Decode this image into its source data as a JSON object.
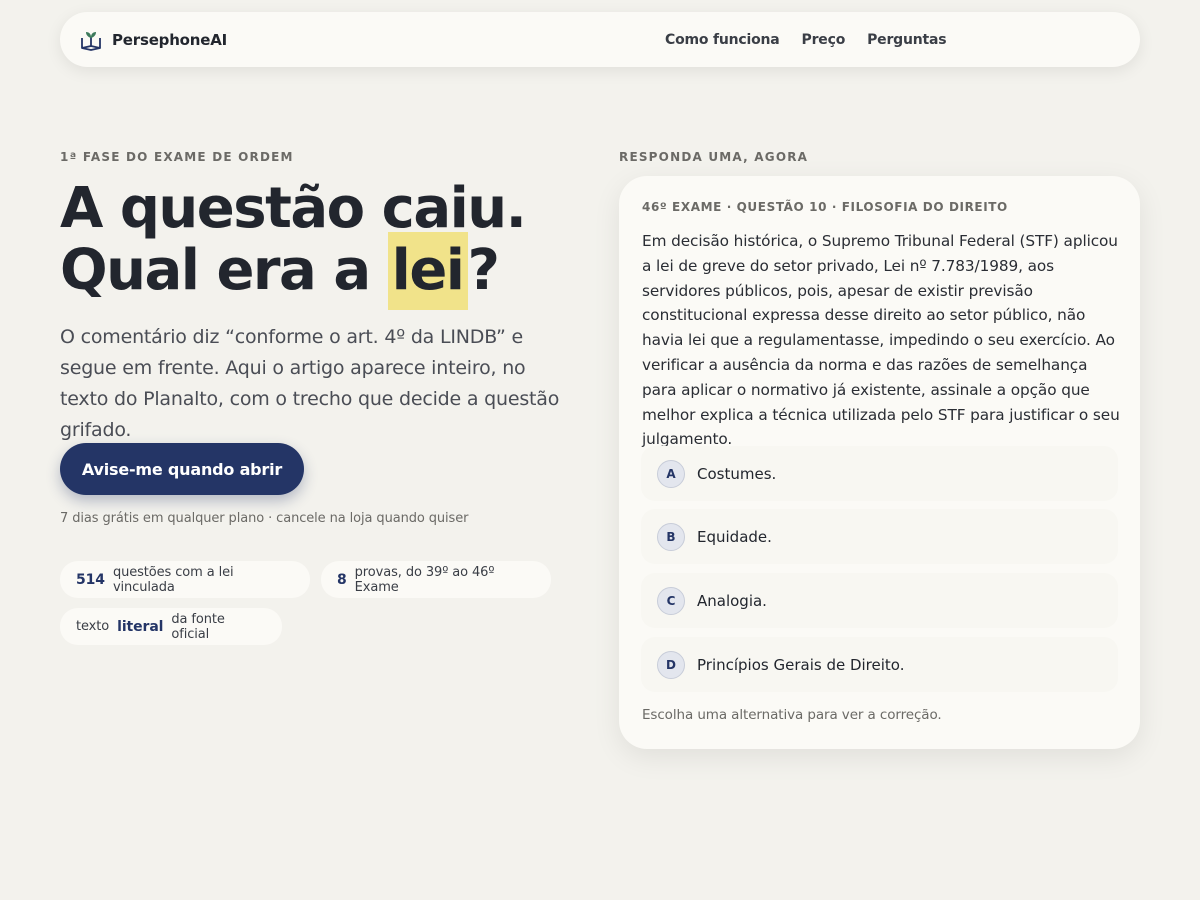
{
  "nav": {
    "brand": "PersephoneAI",
    "brand_icon": "book-sprout-icon",
    "links": [
      "Como funciona",
      "Preço",
      "Perguntas"
    ]
  },
  "hero": {
    "eyebrow": "1ª FASE DO EXAME DE ORDEM",
    "headline_line1": "A questão caiu.",
    "headline_line2_pre": "Qual era a ",
    "headline_highlight": "lei",
    "headline_line2_post": "?",
    "lede": "O comentário diz “conforme o art. 4º da LINDB” e segue em frente. Aqui o artigo aparece inteiro, no texto do Planalto, com o trecho que decide a questão grifado.",
    "cta": "Avise-me quando abrir",
    "cta_note": "7 dias grátis em qualquer plano · cancele na loja quando quiser",
    "stats": [
      {
        "value": "514",
        "label": "questões com a lei vinculada"
      },
      {
        "value": "8",
        "label": "provas, do 39º ao 46º Exame"
      },
      {
        "pre": "texto",
        "value": "literal",
        "label": "da fonte oficial"
      }
    ]
  },
  "card": {
    "eyebrow": "RESPONDA UMA, AGORA",
    "meta": "46º EXAME · QUESTÃO 10 · FILOSOFIA DO DIREITO",
    "question": "Em decisão histórica, o Supremo Tribunal Federal (STF) aplicou a lei de greve do setor privado, Lei nº 7.783/1989, aos servidores públicos, pois, apesar de existir previsão constitucional expressa desse direito ao setor público, não havia lei que a regulamentasse, impedindo o seu exercício. Ao verificar a ausência da norma e das razões de semelhança para aplicar o normativo já existente, assinale a opção que melhor explica a técnica utilizada pelo STF para justificar o seu julgamento.",
    "options": [
      {
        "letter": "A",
        "text": "Costumes."
      },
      {
        "letter": "B",
        "text": "Equidade."
      },
      {
        "letter": "C",
        "text": "Analogia."
      },
      {
        "letter": "D",
        "text": "Princípios Gerais de Direito."
      }
    ],
    "footer": "Escolha uma alternativa para ver a correção."
  },
  "colors": {
    "background": "#f3f2ed",
    "accent": "#243566",
    "highlight": "#f1e38a",
    "card": "#fbfaf6"
  }
}
